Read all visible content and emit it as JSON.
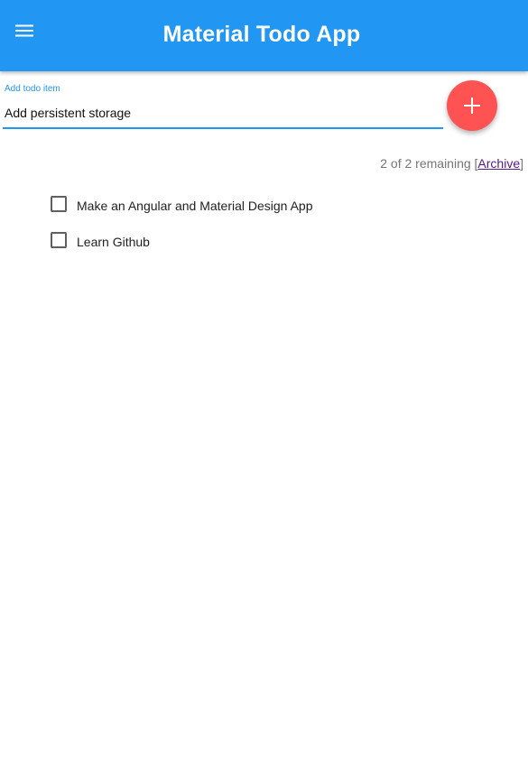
{
  "toolbar": {
    "title": "Material Todo App",
    "menu_icon": "menu-icon",
    "color": "#2196f3"
  },
  "input": {
    "label": "Add todo item",
    "value": "Add persistent storage",
    "accent_color": "#2196f3"
  },
  "fab": {
    "icon": "plus-icon",
    "color": "#ff5252"
  },
  "status": {
    "remaining_text": "2 of 2 remaining [",
    "archive_label": "Archive",
    "close_bracket": "]"
  },
  "todos": [
    {
      "text": "Make an Angular and Material Design App",
      "done": false
    },
    {
      "text": "Learn Github",
      "done": false
    }
  ]
}
